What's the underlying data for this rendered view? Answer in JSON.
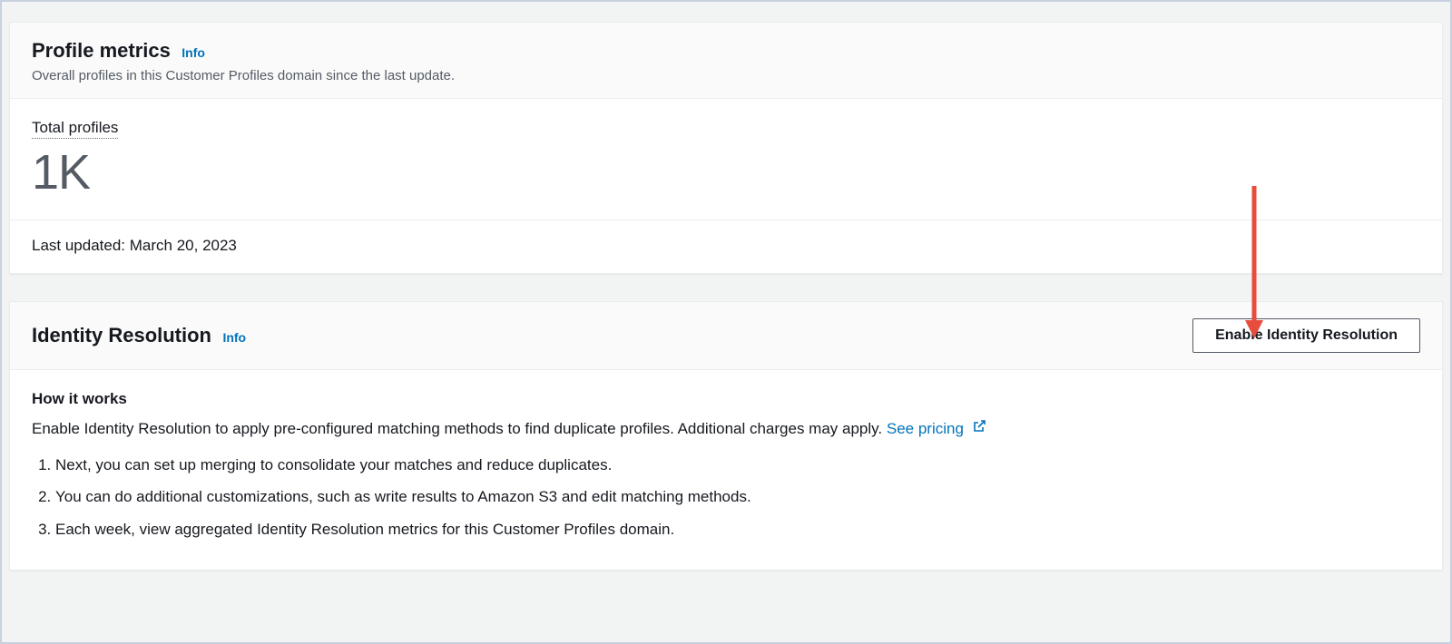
{
  "profile_metrics": {
    "title": "Profile metrics",
    "info_label": "Info",
    "subtitle": "Overall profiles in this Customer Profiles domain since the last update.",
    "total_profiles_label": "Total profiles",
    "total_profiles_value": "1K",
    "last_updated": "Last updated: March 20, 2023"
  },
  "identity_resolution": {
    "title": "Identity Resolution",
    "info_label": "Info",
    "enable_button": "Enable Identity Resolution",
    "how_it_works_heading": "How it works",
    "description": "Enable Identity Resolution to apply pre-configured matching methods to find duplicate profiles. Additional charges may apply. ",
    "pricing_link_text": "See pricing",
    "steps": [
      "Next, you can set up merging to consolidate your matches and reduce duplicates.",
      "You can do additional customizations, such as write results to Amazon S3 and edit matching methods.",
      "Each week, view aggregated Identity Resolution metrics for this Customer Profiles domain."
    ]
  }
}
